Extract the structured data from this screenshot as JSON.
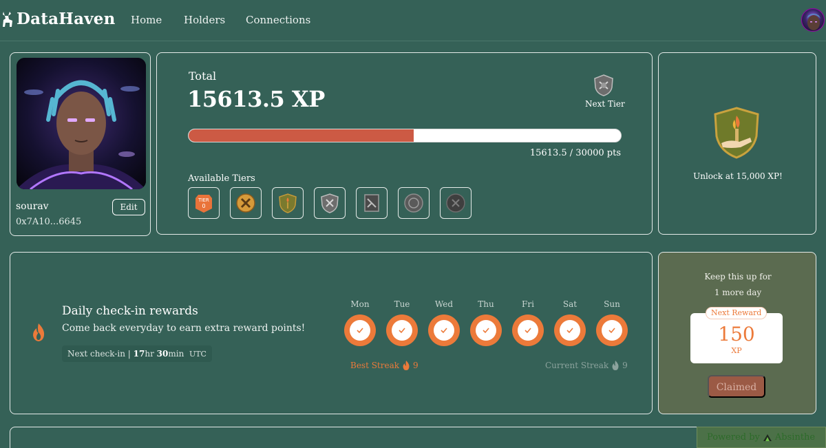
{
  "nav": {
    "brand": "DataHaven",
    "links": [
      "Home",
      "Holders",
      "Connections"
    ]
  },
  "profile": {
    "username": "sourav",
    "address": "0x7A10...6645",
    "edit_label": "Edit"
  },
  "xp": {
    "total_label": "Total",
    "total_value": "15613.5 XP",
    "next_tier_label": "Next Tier",
    "progress_text": "15613.5 / 30000 pts",
    "progress_fraction": 0.52,
    "tiers_label": "Available Tiers",
    "tiers": [
      {
        "name": "tier-0",
        "text": "TIER 0"
      },
      {
        "name": "tier-1"
      },
      {
        "name": "tier-2"
      },
      {
        "name": "tier-3"
      },
      {
        "name": "tier-4"
      },
      {
        "name": "tier-5"
      },
      {
        "name": "tier-6"
      }
    ]
  },
  "unlock": {
    "text": "Unlock at 15,000 XP!"
  },
  "checkin": {
    "title": "Daily check-in rewards",
    "subtitle": "Come back everyday to earn extra reward points!",
    "next_checkin_prefix": "Next check-in |",
    "hours": "17",
    "hours_unit": "hr",
    "minutes": "30",
    "minutes_unit": "min",
    "timezone": "UTC",
    "days": [
      "Mon",
      "Tue",
      "Wed",
      "Thu",
      "Fri",
      "Sat",
      "Sun"
    ],
    "best_streak_label": "Best Streak",
    "best_streak_value": "9",
    "current_streak_label": "Current Streak",
    "current_streak_value": "9"
  },
  "reward": {
    "keep_line1": "Keep this up for",
    "keep_line2": "1 more day",
    "tag": "Next Reward",
    "value": "150",
    "unit": "XP",
    "claimed_label": "Claimed"
  },
  "footer": {
    "powered_prefix": "Powered by",
    "powered_brand": "Absinthe"
  },
  "colors": {
    "background": "#356157",
    "accent": "#ec7a3a",
    "progress": "#cc5a44",
    "reward_panel": "#5b6b50"
  }
}
